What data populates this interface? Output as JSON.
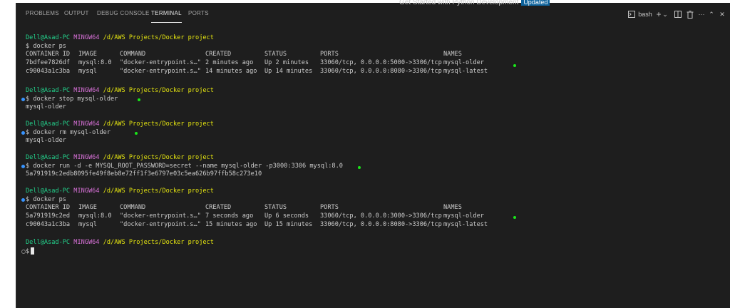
{
  "tabs": [
    {
      "label": "PROBLEMS"
    },
    {
      "label": "OUTPUT"
    },
    {
      "label": "DEBUG CONSOLE"
    },
    {
      "label": "TERMINAL"
    },
    {
      "label": "PORTS"
    }
  ],
  "tooltip": {
    "text": "Get Started with Python Development",
    "badge": "Updated"
  },
  "toolbar": {
    "shell_label": "bash",
    "add_label": "+",
    "chevron": "⌄",
    "trash": "🗑",
    "split": "▯",
    "more": "···",
    "maximize": "⌃",
    "close": "✕"
  },
  "prompt": {
    "user": "Dell@Asad-PC",
    "host": "MINGW64",
    "path": "/d/AWS Projects/Docker project"
  },
  "commands": [
    "$ docker ps",
    "$ docker stop mysql-older",
    "$ docker rm mysql-older",
    "$ docker run -d -e MYSQL_ROOT_PASSWORD=secret --name mysql-older -p3000:3306 mysql:8.0",
    "$ docker ps",
    "$"
  ],
  "ps_headers": [
    "CONTAINER ID",
    "IMAGE",
    "COMMAND",
    "CREATED",
    "STATUS",
    "PORTS",
    "NAMES"
  ],
  "ps1_rows": [
    [
      "7bdfee7826df",
      "mysql:8.0",
      "\"docker-entrypoint.s…\"",
      "2 minutes ago",
      "Up 2 minutes",
      "33060/tcp, 0.0.0.0:5000->3306/tcp",
      "mysql-older"
    ],
    [
      "c90043a1c3ba",
      "mysql",
      "\"docker-entrypoint.s…\"",
      "14 minutes ago",
      "Up 14 minutes",
      "33060/tcp, 0.0.0.0:8080->3306/tcp",
      "mysql-latest"
    ]
  ],
  "outputs": {
    "stop": "mysql-older",
    "rm": "mysql-older",
    "run": "5a791919c2edb8095fe49f8eb8e72ff1f3e6797e03c5ea626b97ffb58c273e10"
  },
  "ps2_rows": [
    [
      "5a791919c2ed",
      "mysql:8.0",
      "\"docker-entrypoint.s…\"",
      "7 seconds ago",
      "Up 6 seconds",
      "33060/tcp, 0.0.0.0:3000->3306/tcp",
      "mysql-older"
    ],
    [
      "c90043a1c3ba",
      "mysql",
      "\"docker-entrypoint.s…\"",
      "15 minutes ago",
      "Up 15 minutes",
      "33060/tcp, 0.0.0.0:8080->3306/tcp",
      "mysql-latest"
    ]
  ],
  "colors": {
    "background": "#1e1e1e",
    "user": "#23d18b",
    "host": "#d670d6",
    "path": "#e5e510",
    "marker": "#19e619"
  }
}
